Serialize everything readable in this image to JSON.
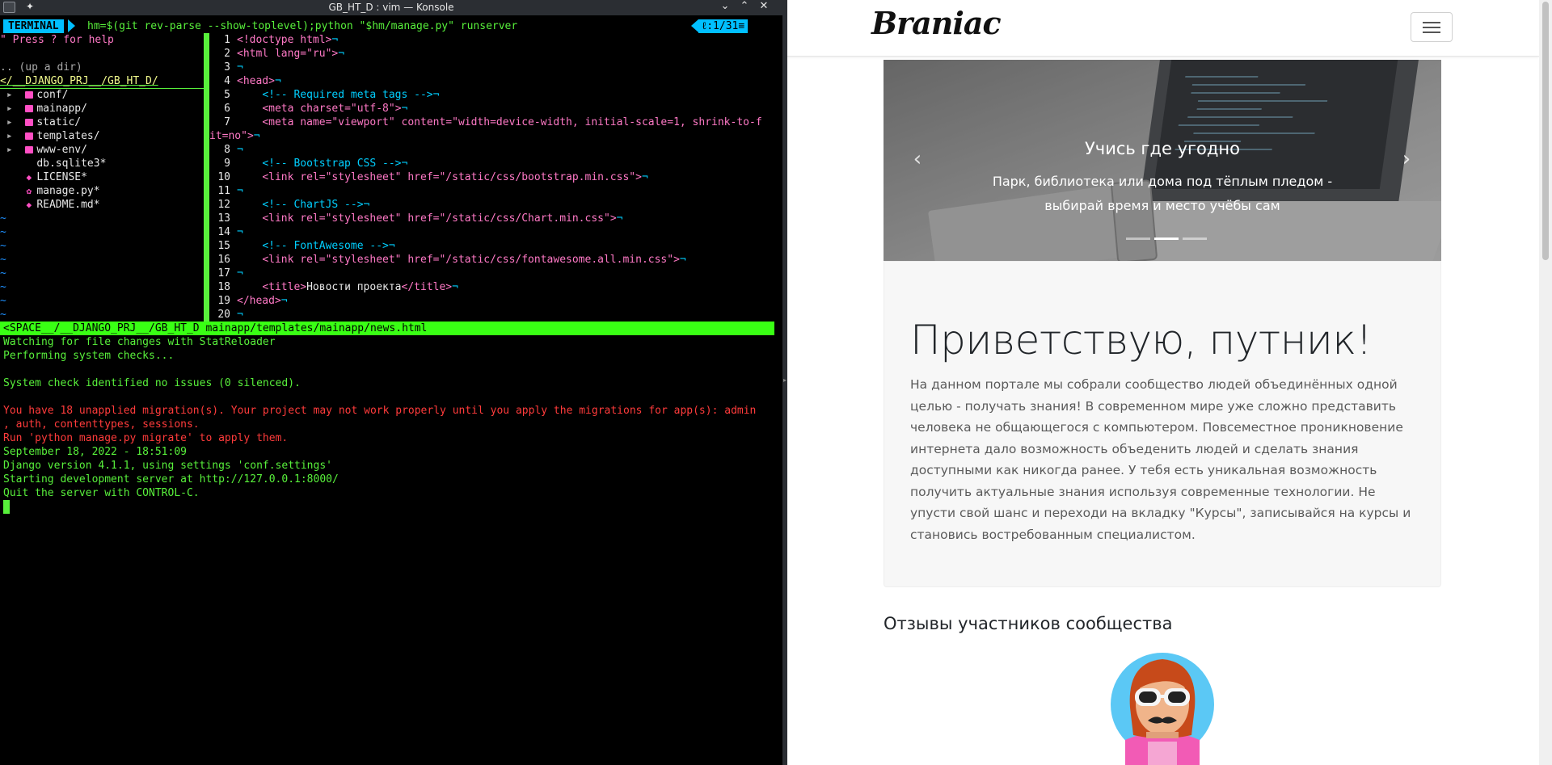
{
  "window": {
    "title": "GB_HT_D : vim — Konsole"
  },
  "vim": {
    "mode": "TERMINAL",
    "command": "hm=$(git rev-parse --show-toplevel);python \"$hm/manage.py\" runserver",
    "position": "ℓ:1/31≡",
    "tree": {
      "help": "\" Press ? for help",
      "up_dir": ".. (up a dir)",
      "cwd": "</__DJANGO_PRJ__/GB_HT_D/",
      "entries": [
        {
          "name": "conf/",
          "type": "dir"
        },
        {
          "name": "mainapp/",
          "type": "dir"
        },
        {
          "name": "static/",
          "type": "dir"
        },
        {
          "name": "templates/",
          "type": "dir"
        },
        {
          "name": "www-env/",
          "type": "dir"
        },
        {
          "name": "db.sqlite3*",
          "type": "file"
        },
        {
          "name": "LICENSE*",
          "type": "file"
        },
        {
          "name": "manage.py*",
          "type": "file"
        },
        {
          "name": "README.md*",
          "type": "file"
        }
      ]
    },
    "code_lines": [
      {
        "n": "1",
        "parts": [
          [
            "tag",
            "<!doctype html>"
          ],
          [
            "nl",
            "¬"
          ]
        ]
      },
      {
        "n": "2",
        "parts": [
          [
            "tag",
            "<html "
          ],
          [
            "attr",
            "lang="
          ],
          [
            "str",
            "\"ru\""
          ],
          [
            "tag",
            ">"
          ],
          [
            "nl",
            "¬"
          ]
        ]
      },
      {
        "n": "3",
        "parts": [
          [
            "nl",
            "¬"
          ]
        ]
      },
      {
        "n": "4",
        "parts": [
          [
            "tag",
            "<head>"
          ],
          [
            "nl",
            "¬"
          ]
        ]
      },
      {
        "n": "5",
        "parts": [
          [
            "plain",
            "    "
          ],
          [
            "cmt",
            "<!-- Required meta tags -->"
          ],
          [
            "nl",
            "¬"
          ]
        ]
      },
      {
        "n": "6",
        "parts": [
          [
            "plain",
            "    "
          ],
          [
            "tag",
            "<meta "
          ],
          [
            "attr",
            "charset="
          ],
          [
            "str",
            "\"utf-8\""
          ],
          [
            "tag",
            ">"
          ],
          [
            "nl",
            "¬"
          ]
        ]
      },
      {
        "n": "7",
        "parts": [
          [
            "plain",
            "    "
          ],
          [
            "tag",
            "<meta "
          ],
          [
            "attr",
            "name="
          ],
          [
            "str",
            "\"viewport\" "
          ],
          [
            "attr",
            "content="
          ],
          [
            "str",
            "\"width=device-width, initial-scale=1, shrink-to-f"
          ]
        ]
      },
      {
        "n": "",
        "parts": [
          [
            "str",
            "it=no\""
          ],
          [
            "tag",
            ">"
          ],
          [
            "nl",
            "¬"
          ]
        ]
      },
      {
        "n": "8",
        "parts": [
          [
            "nl",
            "¬"
          ]
        ]
      },
      {
        "n": "9",
        "parts": [
          [
            "plain",
            "    "
          ],
          [
            "cmt",
            "<!-- Bootstrap CSS -->"
          ],
          [
            "nl",
            "¬"
          ]
        ]
      },
      {
        "n": "10",
        "parts": [
          [
            "plain",
            "    "
          ],
          [
            "tag",
            "<link "
          ],
          [
            "attr",
            "rel="
          ],
          [
            "str",
            "\"stylesheet\" "
          ],
          [
            "attr",
            "href="
          ],
          [
            "str",
            "\"/static/css/bootstrap.min.css\""
          ],
          [
            "tag",
            ">"
          ],
          [
            "nl",
            "¬"
          ]
        ]
      },
      {
        "n": "11",
        "parts": [
          [
            "nl",
            "¬"
          ]
        ]
      },
      {
        "n": "12",
        "parts": [
          [
            "plain",
            "    "
          ],
          [
            "cmt",
            "<!-- ChartJS -->"
          ],
          [
            "nl",
            "¬"
          ]
        ]
      },
      {
        "n": "13",
        "parts": [
          [
            "plain",
            "    "
          ],
          [
            "tag",
            "<link "
          ],
          [
            "attr",
            "rel="
          ],
          [
            "str",
            "\"stylesheet\" "
          ],
          [
            "attr",
            "href="
          ],
          [
            "str",
            "\"/static/css/Chart.min.css\""
          ],
          [
            "tag",
            ">"
          ],
          [
            "nl",
            "¬"
          ]
        ]
      },
      {
        "n": "14",
        "parts": [
          [
            "nl",
            "¬"
          ]
        ]
      },
      {
        "n": "15",
        "parts": [
          [
            "plain",
            "    "
          ],
          [
            "cmt",
            "<!-- FontAwesome -->"
          ],
          [
            "nl",
            "¬"
          ]
        ]
      },
      {
        "n": "16",
        "parts": [
          [
            "plain",
            "    "
          ],
          [
            "tag",
            "<link "
          ],
          [
            "attr",
            "rel="
          ],
          [
            "str",
            "\"stylesheet\" "
          ],
          [
            "attr",
            "href="
          ],
          [
            "str",
            "\"/static/css/fontawesome.all.min.css\""
          ],
          [
            "tag",
            ">"
          ],
          [
            "nl",
            "¬"
          ]
        ]
      },
      {
        "n": "17",
        "parts": [
          [
            "nl",
            "¬"
          ]
        ]
      },
      {
        "n": "18",
        "parts": [
          [
            "plain",
            "    "
          ],
          [
            "tag",
            "<title>"
          ],
          [
            "plain",
            "Новости проекта"
          ],
          [
            "tag",
            "</title>"
          ],
          [
            "nl",
            "¬"
          ]
        ]
      },
      {
        "n": "19",
        "parts": [
          [
            "tag",
            "</head>"
          ],
          [
            "nl",
            "¬"
          ]
        ]
      },
      {
        "n": "20",
        "parts": [
          [
            "nl",
            "¬"
          ]
        ]
      }
    ],
    "statusline": "<SPACE__/__DJANGO_PRJ__/GB_HT_D mainapp/templates/mainapp/news.html"
  },
  "server_output": [
    {
      "c": "g",
      "t": "Watching for file changes with StatReloader"
    },
    {
      "c": "g",
      "t": "Performing system checks..."
    },
    {
      "c": "g",
      "t": ""
    },
    {
      "c": "g",
      "t": "System check identified no issues (0 silenced)."
    },
    {
      "c": "g",
      "t": ""
    },
    {
      "c": "r",
      "t": "You have 18 unapplied migration(s). Your project may not work properly until you apply the migrations for app(s): admin"
    },
    {
      "c": "r",
      "t": ", auth, contenttypes, sessions."
    },
    {
      "c": "r",
      "t": "Run 'python manage.py migrate' to apply them."
    },
    {
      "c": "g",
      "t": "September 18, 2022 - 18:51:09"
    },
    {
      "c": "g",
      "t": "Django version 4.1.1, using settings 'conf.settings'"
    },
    {
      "c": "g",
      "t": "Starting development server at http://127.0.0.1:8000/"
    },
    {
      "c": "g",
      "t": "Quit the server with CONTROL-C."
    }
  ],
  "site": {
    "brand": "Braniac",
    "carousel": {
      "title": "Учись где угодно",
      "text": "Парк, библиотека или дома под тёплым пледом - выбирай время и место учёбы сам",
      "prev_glyph": "‹",
      "next_glyph": "›",
      "slide_count": 3,
      "active_slide": 2
    },
    "jumbotron": {
      "title": "Приветствую, путник!",
      "text": "На данном портале мы собрали сообщество людей объединённых одной целью - получать знания! В современном мире уже сложно представить человека не общающегося с компьютером. Повсеместное проникновение интернета дало возможность объеденить людей и сделать знания доступными как никогда ранее. У тебя есть уникальная возможность получить актуальные знания используя современные технологии. Не упусти свой шанс и переходи на вкладку \"Курсы\", записывайся на курсы и становись востребованным специалистом."
    },
    "reviews_title": "Отзывы участников сообщества"
  },
  "colors": {
    "terminal_green": "#58f03b",
    "terminal_red": "#ff3b3b",
    "accent_cyan": "#00bfff",
    "pink": "#ff79c6"
  }
}
